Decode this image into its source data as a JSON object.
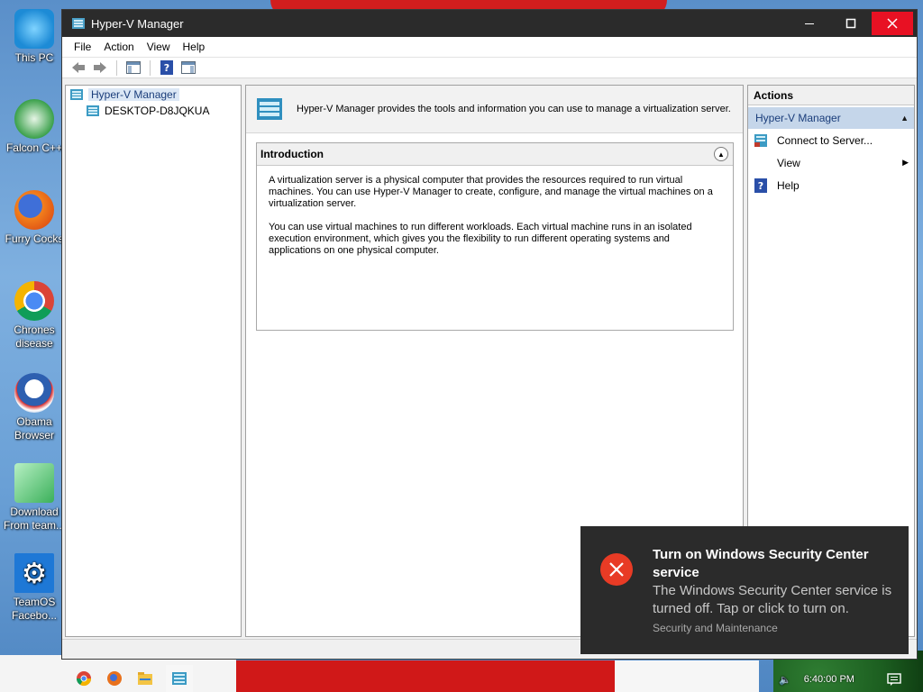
{
  "desktop": {
    "icons": [
      {
        "label": "This PC"
      },
      {
        "label": "Falcon C++"
      },
      {
        "label": "Furry Cocks"
      },
      {
        "label": "Chrones disease"
      },
      {
        "label": "Obama Browser"
      },
      {
        "label": "Download From team..."
      },
      {
        "label": "TeamOS Facebo..."
      }
    ]
  },
  "window": {
    "title": "Hyper-V Manager",
    "menu": [
      "File",
      "Action",
      "View",
      "Help"
    ]
  },
  "tree": {
    "root": "Hyper-V Manager",
    "child": "DESKTOP-D8JQKUA"
  },
  "center": {
    "header_text": "Hyper-V Manager provides the tools and information you can use to manage a virtualization server.",
    "intro": {
      "title": "Introduction",
      "para1": "A virtualization server is a physical computer that provides the resources required to run virtual machines. You can use Hyper-V Manager to create, configure, and manage the virtual machines on a virtualization server.",
      "para2": "You can use virtual machines to run different workloads. Each virtual machine runs in an isolated execution environment, which gives you the flexibility to run different operating systems and applications on one physical computer."
    }
  },
  "actions": {
    "title": "Actions",
    "group": "Hyper-V Manager",
    "items": [
      "Connect to Server...",
      "View",
      "Help"
    ]
  },
  "toast": {
    "title": "Turn on Windows Security Center service",
    "body": "The Windows Security Center service is turned off. Tap or click to turn on.",
    "source": "Security and Maintenance"
  },
  "taskbar": {
    "clock": "6:40:00 PM"
  },
  "colors": {
    "title_bar": "#2b2b2b",
    "close_button": "#e81123",
    "toast_bg": "#2b2b2b",
    "toast_error": "#e83b25",
    "tree_selected": "#dbe7f5",
    "actions_group": "#c5d6ea"
  }
}
